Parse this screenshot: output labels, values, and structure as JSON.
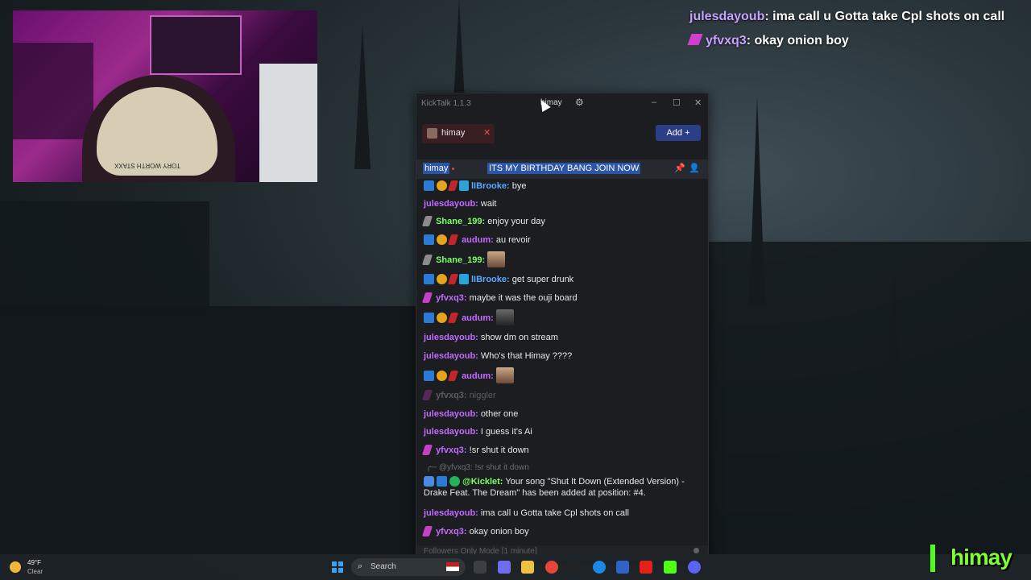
{
  "overlay_chat": [
    {
      "user": "julesdayoub",
      "message": "ima call u Gotta take Cpl shots on call"
    },
    {
      "user": "yfvxq3",
      "message": "okay onion boy"
    }
  ],
  "webcam": {
    "cap_text": "TORY WORTH STAXX"
  },
  "window": {
    "app_title": "KickTalk 1.1.3",
    "user": "himay",
    "minimize": "–",
    "maximize": "☐",
    "close": "✕"
  },
  "tabs": [
    {
      "label": "himay",
      "close": "✕"
    }
  ],
  "add_button": "Add +",
  "pinned": {
    "user": "himay",
    "message": "ITS MY BIRTHDAY BANG JOIN NOW"
  },
  "messages": [
    {
      "user": "lIBrooke:",
      "text": "bye"
    },
    {
      "user": "julesdayoub:",
      "text": "wait"
    },
    {
      "user": "Shane_199:",
      "text": "enjoy your day"
    },
    {
      "user": "audum:",
      "text": "au revoir"
    },
    {
      "user": "Shane_199:",
      "text": ""
    },
    {
      "user": "lIBrooke:",
      "text": "get super drunk"
    },
    {
      "user": "yfvxq3:",
      "text": "maybe it was the ouji board"
    },
    {
      "user": "audum:",
      "text": ""
    },
    {
      "user": "julesdayoub:",
      "text": "show dm on stream"
    },
    {
      "user": "julesdayoub:",
      "text": "Who's that Himay ????"
    },
    {
      "user": "audum:",
      "text": ""
    },
    {
      "user": "yfvxq3:",
      "text": "niggler"
    },
    {
      "user": "julesdayoub:",
      "text": "other one"
    },
    {
      "user": "julesdayoub:",
      "text": "I guess it's Ai"
    },
    {
      "user": "yfvxq3:",
      "text": "!sr shut it down"
    },
    {
      "reply": "@yfvxq3: !sr shut it down"
    },
    {
      "user": "@Kicklet:",
      "text": "Your song \"Shut It Down (Extended Version) - Drake Feat. The Dream\" has been added at position: #4."
    },
    {
      "user": "julesdayoub:",
      "text": "ima call u Gotta take Cpl shots on call"
    },
    {
      "user": "yfvxq3:",
      "text": "okay onion boy"
    }
  ],
  "followers_mode": "Followers Only Mode [1 minute]",
  "taskbar": {
    "weather_temp": "49°F",
    "weather_cond": "Clear",
    "search_label": "Search"
  },
  "logo": "himay"
}
